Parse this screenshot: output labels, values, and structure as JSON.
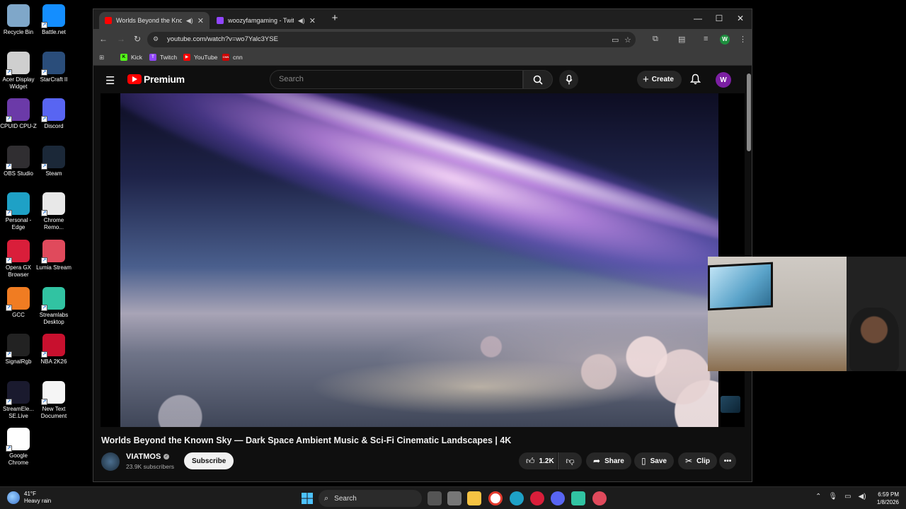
{
  "desktop": {
    "icons": [
      {
        "label": "Recycle Bin",
        "icon": "recycle-bin-icon",
        "color": "#7fa7c9"
      },
      {
        "label": "Battle.net",
        "icon": "battlenet-icon",
        "color": "#148eff"
      },
      {
        "label": "Acer Display Widget",
        "icon": "acer-display-icon",
        "color": "#cfcfcf"
      },
      {
        "label": "StarCraft II",
        "icon": "starcraft-icon",
        "color": "#2a4d7a"
      },
      {
        "label": "CPUID CPU-Z",
        "icon": "cpuz-icon",
        "color": "#6b3aa8"
      },
      {
        "label": "Discord",
        "icon": "discord-icon",
        "color": "#5865f2"
      },
      {
        "label": "OBS Studio",
        "icon": "obs-icon",
        "color": "#302e31"
      },
      {
        "label": "Steam",
        "icon": "steam-icon",
        "color": "#1b2838"
      },
      {
        "label": "Personal - Edge",
        "icon": "edge-icon",
        "color": "#1ea1c6"
      },
      {
        "label": "Chrome Remo...",
        "icon": "chrome-remote-icon",
        "color": "#e8e8e8"
      },
      {
        "label": "Opera GX Browser",
        "icon": "opera-gx-icon",
        "color": "#d91e3a"
      },
      {
        "label": "Lumia Stream",
        "icon": "lumia-icon",
        "color": "#e04a5c"
      },
      {
        "label": "GCC",
        "icon": "gcc-icon",
        "color": "#f07c22"
      },
      {
        "label": "Streamlabs Desktop",
        "icon": "streamlabs-icon",
        "color": "#31c3a2"
      },
      {
        "label": "SignalRgb",
        "icon": "signalrgb-icon",
        "color": "#222222"
      },
      {
        "label": "NBA 2K26",
        "icon": "nba2k-icon",
        "color": "#c8102e"
      },
      {
        "label": "StreamEle... SE.Live",
        "icon": "streamelements-icon",
        "color": "#1a1a2e"
      },
      {
        "label": "New Text Document",
        "icon": "text-document-icon",
        "color": "#f5f5f5"
      },
      {
        "label": "Google Chrome",
        "icon": "chrome-icon",
        "color": "#ffffff"
      }
    ]
  },
  "browser": {
    "tabs": [
      {
        "title": "Worlds Beyond the Known",
        "favicon_color": "#ff0000",
        "active": true
      },
      {
        "title": "woozyfamgaming - Twitch",
        "favicon_color": "#9146ff",
        "active": false
      }
    ],
    "new_tab": "+",
    "url": "youtube.com/watch?v=wo7Yalc3YSE",
    "profile_initial": "W",
    "bookmarks": [
      {
        "label": "Kick",
        "color": "#53fc18",
        "icon_text": "K"
      },
      {
        "label": "Twitch",
        "color": "#9146ff",
        "icon_text": "T"
      },
      {
        "label": "YouTube",
        "color": "#ff0000",
        "icon_text": "▶"
      },
      {
        "label": "cnn",
        "color": "#cc0000",
        "icon_text": "CNN"
      }
    ]
  },
  "youtube": {
    "logo_text": "Premium",
    "search_placeholder": "Search",
    "create_label": "Create",
    "avatar_initial": "W",
    "video_title": "Worlds Beyond the Known Sky — Dark Space Ambient Music & Sci-Fi Cinematic Landscapes | 4K",
    "channel_name": "VIATMOS",
    "subscribers": "23.9K subscribers",
    "subscribe_label": "Subscribe",
    "likes": "1.2K",
    "share_label": "Share",
    "save_label": "Save",
    "clip_label": "Clip"
  },
  "taskbar": {
    "weather_temp": "41°F",
    "weather_desc": "Heavy rain",
    "search_label": "Search",
    "time": "6:59 PM",
    "date": "1/8/2026"
  }
}
